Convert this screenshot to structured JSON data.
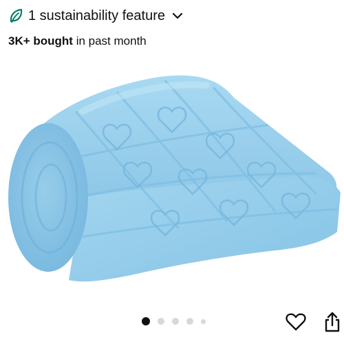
{
  "sustainability": {
    "label": "1 sustainability feature",
    "icon": "leaf-icon",
    "accent": "#067d62"
  },
  "purchase_stats": {
    "count": "3K+ bought",
    "suffix": " in past month"
  },
  "image_gallery": {
    "current": 1,
    "total_dots": 5,
    "product_color": "#9fd3ee"
  },
  "actions": {
    "wishlist_icon": "heart-outline-icon",
    "share_icon": "share-icon"
  }
}
